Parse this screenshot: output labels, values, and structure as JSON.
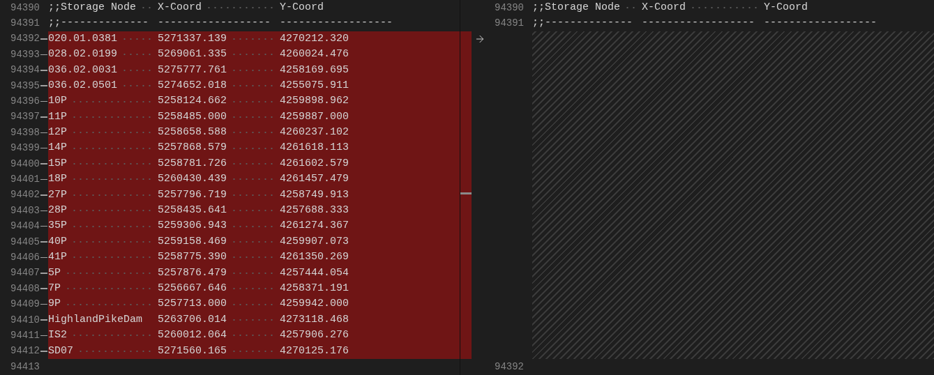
{
  "left": {
    "lines": [
      {
        "number": "94390",
        "kind": "context",
        "cells": [
          ";;Storage Node",
          "X-Coord",
          "Y-Coord"
        ]
      },
      {
        "number": "94391",
        "kind": "context",
        "cells": [
          ";;--------------",
          "------------------",
          "------------------"
        ]
      },
      {
        "number": "94392",
        "kind": "deleted",
        "cells": [
          "020.01.0381",
          "5271337.139",
          "4270212.320"
        ]
      },
      {
        "number": "94393",
        "kind": "deleted",
        "cells": [
          "028.02.0199",
          "5269061.335",
          "4260024.476"
        ]
      },
      {
        "number": "94394",
        "kind": "deleted",
        "cells": [
          "036.02.0031",
          "5275777.761",
          "4258169.695"
        ]
      },
      {
        "number": "94395",
        "kind": "deleted",
        "cells": [
          "036.02.0501",
          "5274652.018",
          "4255075.911"
        ]
      },
      {
        "number": "94396",
        "kind": "deleted",
        "cells": [
          "10P",
          "5258124.662",
          "4259898.962"
        ]
      },
      {
        "number": "94397",
        "kind": "deleted",
        "cells": [
          "11P",
          "5258485.000",
          "4259887.000"
        ]
      },
      {
        "number": "94398",
        "kind": "deleted",
        "cells": [
          "12P",
          "5258658.588",
          "4260237.102"
        ]
      },
      {
        "number": "94399",
        "kind": "deleted",
        "cells": [
          "14P",
          "5257868.579",
          "4261618.113"
        ]
      },
      {
        "number": "94400",
        "kind": "deleted",
        "cells": [
          "15P",
          "5258781.726",
          "4261602.579"
        ]
      },
      {
        "number": "94401",
        "kind": "deleted",
        "cells": [
          "18P",
          "5260430.439",
          "4261457.479"
        ]
      },
      {
        "number": "94402",
        "kind": "deleted",
        "cells": [
          "27P",
          "5257796.719",
          "4258749.913"
        ]
      },
      {
        "number": "94403",
        "kind": "deleted",
        "cells": [
          "28P",
          "5258435.641",
          "4257688.333"
        ]
      },
      {
        "number": "94404",
        "kind": "deleted",
        "cells": [
          "35P",
          "5259306.943",
          "4261274.367"
        ]
      },
      {
        "number": "94405",
        "kind": "deleted",
        "cells": [
          "40P",
          "5259158.469",
          "4259907.073"
        ]
      },
      {
        "number": "94406",
        "kind": "deleted",
        "cells": [
          "41P",
          "5258775.390",
          "4261350.269"
        ]
      },
      {
        "number": "94407",
        "kind": "deleted",
        "cells": [
          "5P",
          "5257876.479",
          "4257444.054"
        ]
      },
      {
        "number": "94408",
        "kind": "deleted",
        "cells": [
          "7P",
          "5256667.646",
          "4258371.191"
        ]
      },
      {
        "number": "94409",
        "kind": "deleted",
        "cells": [
          "9P",
          "5257713.000",
          "4259942.000"
        ]
      },
      {
        "number": "94410",
        "kind": "deleted",
        "cells": [
          "HighlandPikeDam",
          "5263706.014",
          "4273118.468"
        ]
      },
      {
        "number": "94411",
        "kind": "deleted",
        "cells": [
          "IS2",
          "5260012.064",
          "4257906.276"
        ]
      },
      {
        "number": "94412",
        "kind": "deleted",
        "cells": [
          "SD07",
          "5271560.165",
          "4270125.176"
        ]
      },
      {
        "number": "94413",
        "kind": "context"
      }
    ]
  },
  "right": {
    "lines": [
      {
        "number": "94390",
        "kind": "context",
        "cells": [
          ";;Storage Node",
          "X-Coord",
          "Y-Coord"
        ]
      },
      {
        "number": "94391",
        "kind": "context",
        "cells": [
          ";;--------------",
          "------------------",
          "------------------"
        ]
      },
      {
        "kind": "gap"
      },
      {
        "number": "94392",
        "kind": "context"
      }
    ]
  }
}
